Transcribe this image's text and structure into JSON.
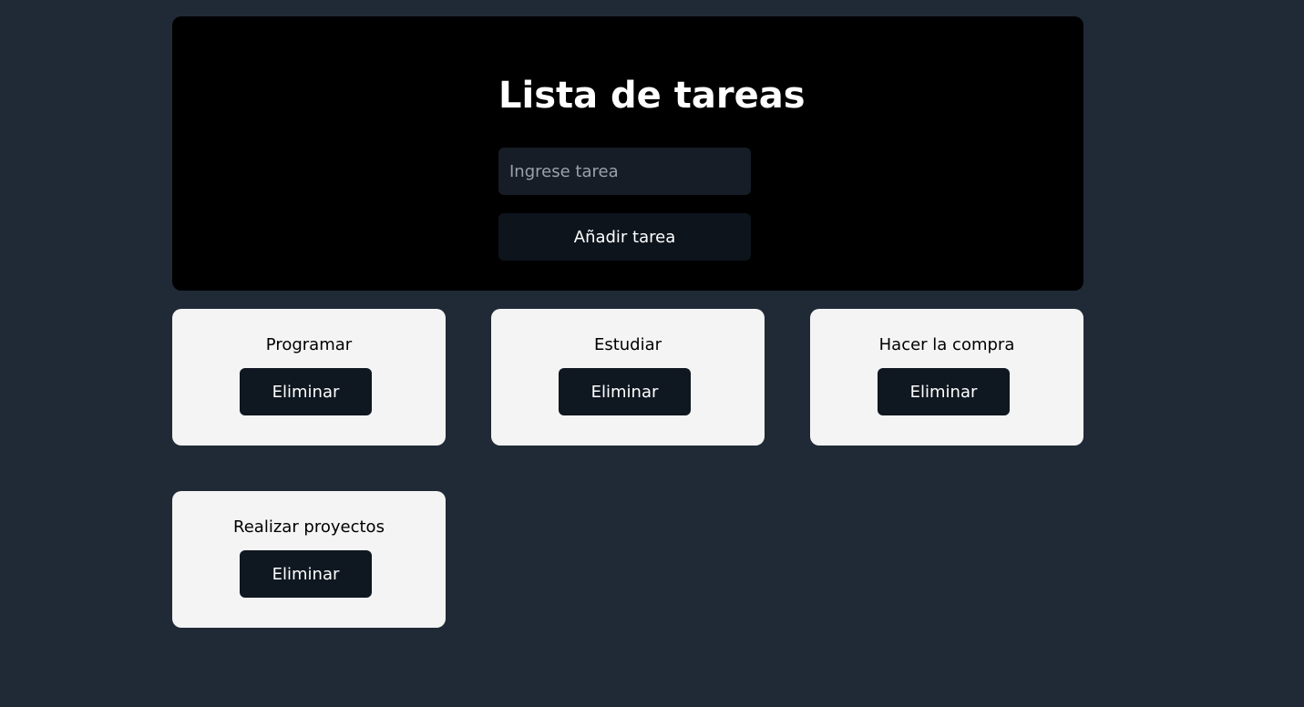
{
  "header": {
    "title": "Lista de tareas",
    "input_placeholder": "Ingrese tarea",
    "input_value": "",
    "add_label": "Añadir tarea"
  },
  "tasks": [
    {
      "name": "Programar",
      "delete_label": "Eliminar"
    },
    {
      "name": "Estudiar",
      "delete_label": "Eliminar"
    },
    {
      "name": "Hacer la compra",
      "delete_label": "Eliminar"
    },
    {
      "name": "Realizar proyectos",
      "delete_label": "Eliminar"
    }
  ],
  "colors": {
    "background": "#1f2a36",
    "header_panel": "#000000",
    "card": "#f4f4f4",
    "button": "#0f1720"
  }
}
